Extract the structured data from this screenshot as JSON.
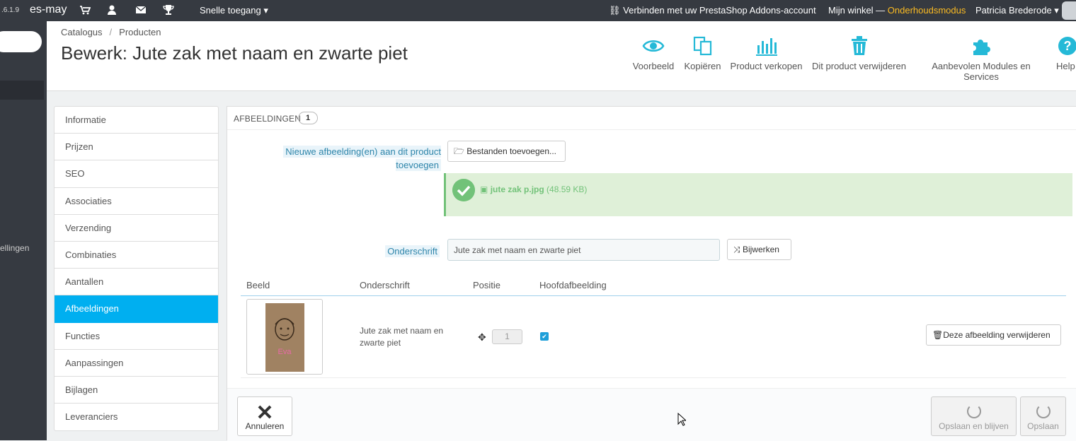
{
  "topbar": {
    "version": ".6.1.9",
    "shop_name": "es-may",
    "quick_access": "Snelle toegang",
    "addons": "Verbinden met uw PrestaShop Addons-account",
    "store": "Mijn winkel — ",
    "maintenance": "Onderhoudsmodus",
    "user": "Patricia Brederode"
  },
  "sidebar": {
    "partial_label": "ellingen"
  },
  "breadcrumb": {
    "parent": "Catalogus",
    "separator": "/",
    "current": "Producten"
  },
  "page_title": "Bewerk: Jute zak met naam en zwarte piet",
  "toolbar": {
    "preview": "Voorbeeld",
    "copy": "Kopiëren",
    "sales": "Product verkopen",
    "delete": "Dit product verwijderen",
    "modules": "Aanbevolen Modules en Services",
    "help": "Help"
  },
  "tabs": [
    "Informatie",
    "Prijzen",
    "SEO",
    "Associaties",
    "Verzending",
    "Combinaties",
    "Aantallen",
    "Afbeeldingen",
    "Functies",
    "Aanpassingen",
    "Bijlagen",
    "Leveranciers"
  ],
  "active_tab": "Afbeeldingen",
  "panel": {
    "title": "AFBEELDINGEN",
    "count": "1",
    "new_images_label": "Nieuwe afbeelding(en) aan dit product toevoegen",
    "add_files_button": "Bestanden toevoegen...",
    "uploaded_file": "jute zak p.jpg",
    "uploaded_size": "(48.59 KB)",
    "caption_label": "Onderschrift",
    "caption_value": "Jute zak met naam en zwarte piet",
    "update_button": "Bijwerken",
    "table": {
      "headers": [
        "Beeld",
        "Onderschrift",
        "Positie",
        "Hoofdafbeelding"
      ],
      "rows": [
        {
          "caption": "Jute zak met naam en zwarte piet",
          "position": "1",
          "cover": true,
          "image_text": "Eva",
          "delete_label": "Deze afbeelding verwijderen"
        }
      ]
    },
    "footer": {
      "cancel": "Annuleren",
      "save_stay": "Opslaan en blijven",
      "save": "Opslaan"
    }
  },
  "colors": {
    "accent": "#00aff0",
    "topbar": "#363a41",
    "success": "#72c279",
    "maintenance": "#fbbb22"
  }
}
